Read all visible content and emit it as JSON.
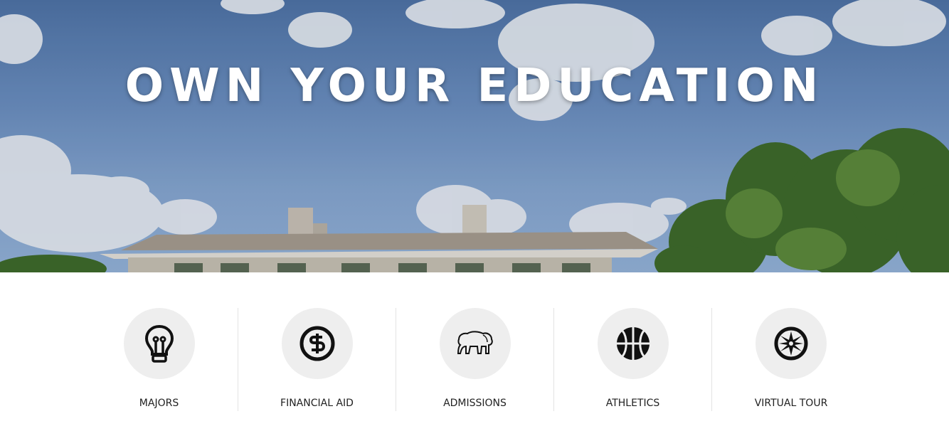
{
  "hero": {
    "title": "OWN YOUR EDUCATION"
  },
  "quick_links": [
    {
      "label": "MAJORS",
      "icon": "lightbulb-icon"
    },
    {
      "label": "FINANCIAL AID",
      "icon": "dollar-icon"
    },
    {
      "label": "ADMISSIONS",
      "icon": "bison-icon"
    },
    {
      "label": "ATHLETICS",
      "icon": "basketball-icon"
    },
    {
      "label": "VIRTUAL TOUR",
      "icon": "compass-icon"
    }
  ],
  "colors": {
    "sky": "#6c90c2",
    "icon_bg": "#eeeeee",
    "icon": "#111111",
    "label": "#222222"
  }
}
